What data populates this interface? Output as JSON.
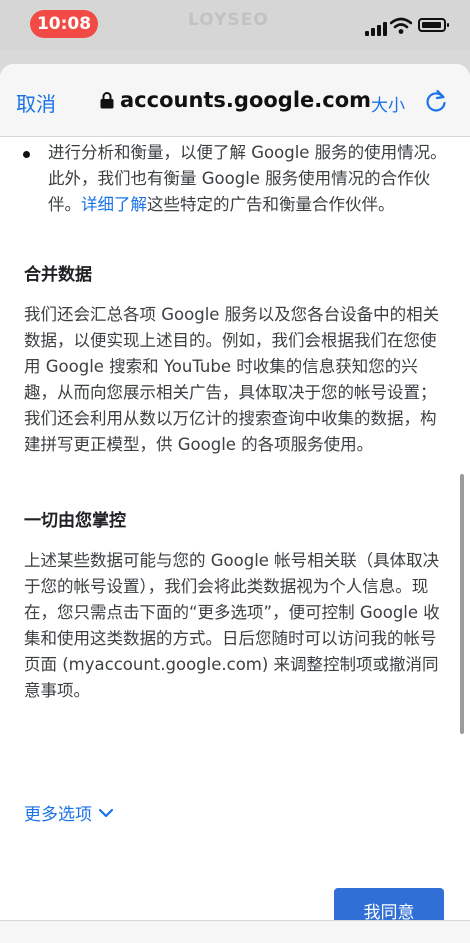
{
  "status_bar": {
    "time": "10:08",
    "watermark": "LOYSEO"
  },
  "nav": {
    "cancel_label": "取消",
    "url": "accounts.google.com",
    "text_size_label": "大小"
  },
  "content": {
    "bullet_text_1": "进行分析和衡量，以便了解 Google 服务的使用情况。此外，我们也有衡量 Google 服务使用情况的合作伙伴。",
    "bullet_link": "详细了解",
    "bullet_text_2": "这些特定的广告和衡量合作伙伴。",
    "section1_title": "合并数据",
    "section1_body": "我们还会汇总各项 Google 服务以及您各台设备中的相关数据，以便实现上述目的。例如，我们会根据我们在您使用 Google 搜索和 YouTube 时收集的信息获知您的兴趣，从而向您展示相关广告，具体取决于您的帐号设置；我们还会利用从数以万亿计的搜索查询中收集的数据，构建拼写更正模型，供 Google 的各项服务使用。",
    "section2_title": "一切由您掌控",
    "section2_body": "上述某些数据可能与您的 Google 帐号相关联（具体取决于您的帐号设置），我们会将此类数据视为个人信息。现在，您只需点击下面的“更多选项”，便可控制 Google 收集和使用这类数据的方式。日后您随时可以访问我的帐号页面 (myaccount.google.com) 来调整控制项或撤消同意事项。",
    "more_options_label": "更多选项",
    "agree_label": "我同意"
  }
}
